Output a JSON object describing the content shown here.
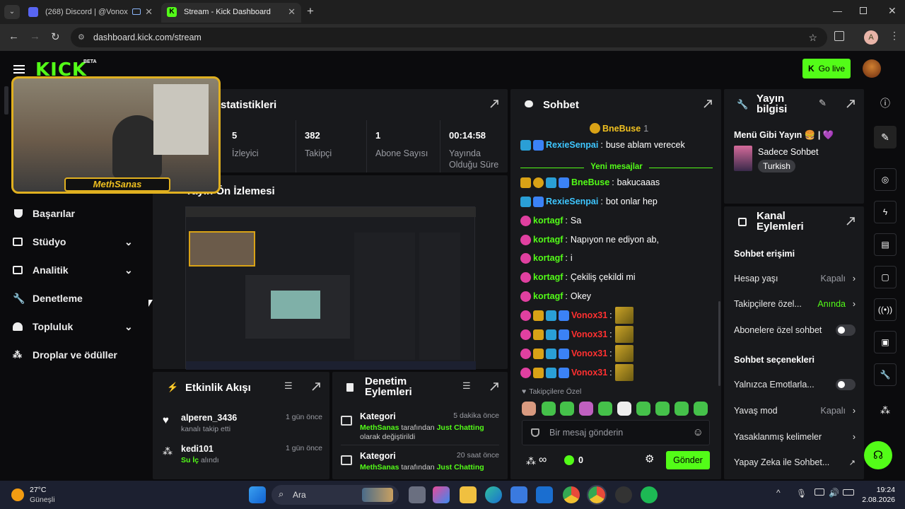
{
  "browser": {
    "tabs": [
      {
        "title": "(268) Discord | @Vonox",
        "badge": "268"
      },
      {
        "title": "Stream - Kick Dashboard"
      }
    ],
    "url": "dashboard.kick.com/stream",
    "profile_initial": "A"
  },
  "header": {
    "logo": "KICK",
    "logo_badge": "BETA",
    "go_live": "Go live"
  },
  "webcam": {
    "streamer_name": "MethSanas"
  },
  "sidebar": {
    "items": [
      {
        "label": "Başarılar",
        "icon": "trophy-icon",
        "expandable": false
      },
      {
        "label": "Stüdyo",
        "icon": "studio-icon",
        "expandable": true
      },
      {
        "label": "Analitik",
        "icon": "analytics-icon",
        "expandable": true
      },
      {
        "label": "Denetleme",
        "icon": "wrench-icon",
        "expandable": false
      },
      {
        "label": "Topluluk",
        "icon": "community-icon",
        "expandable": true
      },
      {
        "label": "Droplar ve ödüller",
        "icon": "drops-icon",
        "expandable": false
      }
    ]
  },
  "stats": {
    "title": "statistikleri",
    "items": [
      {
        "value": "5",
        "label": "İzleyici"
      },
      {
        "value": "382",
        "label": "Takipçi"
      },
      {
        "value": "1",
        "label": "Abone Sayısı"
      },
      {
        "value": "00:14:58",
        "label": "Yayında Olduğu Süre"
      }
    ]
  },
  "preview": {
    "title": "Yayın Ön İzlemesi"
  },
  "activity": {
    "title": "Etkinlik Akışı",
    "items": [
      {
        "user": "alperen_3436",
        "desc": "kanalı takip etti",
        "time": "1 gün önce",
        "icon": "heart-icon"
      },
      {
        "user": "kedi101",
        "desc_pre": "Su İç",
        "desc": "alındı",
        "time": "1 gün önce",
        "icon": "drops-icon"
      }
    ]
  },
  "moderation": {
    "title": "Denetim Eylemleri",
    "items": [
      {
        "title": "Kategori",
        "time": "5 dakika önce",
        "user": "MethSanas",
        "mid": "tarafından",
        "target": "Just Chatting",
        "rest": "olarak değiştirildi"
      },
      {
        "title": "Kategori",
        "time": "20 saat önce",
        "user": "MethSanas",
        "mid": "tarafından",
        "target": "Just Chatting",
        "rest": ""
      }
    ]
  },
  "chat": {
    "title": "Sohbet",
    "top_user": "BneBuse",
    "top_count": "1",
    "new_messages": "Yeni mesajlar",
    "messages": [
      {
        "user": "RexieSenpai",
        "text": "buse ablam verecek",
        "color": "#3ec6ff",
        "badges": [
          "b-og",
          "b-pin"
        ]
      },
      {
        "user": "BneBuse",
        "text": "bakucaaas",
        "color": "#53fc18",
        "badges": [
          "b-crown",
          "b-gold",
          "b-og",
          "b-pin"
        ]
      },
      {
        "user": "RexieSenpai",
        "text": "bot onlar hep",
        "color": "#3ec6ff",
        "badges": [
          "b-og",
          "b-pin"
        ]
      },
      {
        "user": "kortagf",
        "text": "Sa",
        "color": "#53fc18",
        "badges": [
          "b-sub"
        ]
      },
      {
        "user": "kortagf",
        "text": "Napıyon ne ediyon ab,",
        "color": "#53fc18",
        "badges": [
          "b-sub"
        ]
      },
      {
        "user": "kortagf",
        "text": "i",
        "color": "#53fc18",
        "badges": [
          "b-sub"
        ]
      },
      {
        "user": "kortagf",
        "text": "Çekiliş çekildi mi",
        "color": "#53fc18",
        "badges": [
          "b-sub"
        ]
      },
      {
        "user": "kortagf",
        "text": "Okey",
        "color": "#53fc18",
        "badges": [
          "b-sub"
        ]
      },
      {
        "user": "Vonox31",
        "text": "",
        "color": "#ff3030",
        "badges": [
          "b-sub",
          "b-crown",
          "b-og",
          "b-pin"
        ],
        "emote": true
      },
      {
        "user": "Vonox31",
        "text": "",
        "color": "#ff3030",
        "badges": [
          "b-sub",
          "b-crown",
          "b-og",
          "b-pin"
        ],
        "emote": true
      },
      {
        "user": "Vonox31",
        "text": "",
        "color": "#ff3030",
        "badges": [
          "b-sub",
          "b-crown",
          "b-og",
          "b-pin"
        ],
        "emote": true
      },
      {
        "user": "Vonox31",
        "text": "",
        "color": "#ff3030",
        "badges": [
          "b-sub",
          "b-crown",
          "b-og",
          "b-pin"
        ],
        "emote": true
      }
    ],
    "followers_only": "Takipçilere Özel",
    "input_placeholder": "Bir mesaj gönderin",
    "points": "0",
    "send": "Gönder"
  },
  "stream_info": {
    "title": "Yayın bilgisi",
    "stream_title": "Menü Gibi Yayın 🍔 | 💜",
    "category": "Sadece Sohbet",
    "tag": "Turkish"
  },
  "channel_actions": {
    "title": "Kanal Eylemleri",
    "chat_access": "Sohbet erişimi",
    "account_age": {
      "label": "Hesap yaşı",
      "value": "Kapalı"
    },
    "followers": {
      "label": "Takipçilere özel...",
      "value": "Anında"
    },
    "subscribers": {
      "label": "Abonelere özel sohbet"
    },
    "chat_options": "Sohbet seçenekleri",
    "emotes_only": {
      "label": "Yalnızca Emotlarla..."
    },
    "slow_mode": {
      "label": "Yavaş mod",
      "value": "Kapalı"
    },
    "banned_words": {
      "label": "Yasaklanmış kelimeler"
    },
    "ai_chat": {
      "label": "Yapay Zeka ile Sohbet..."
    }
  },
  "taskbar": {
    "temp": "27°C",
    "weather": "Güneşli",
    "search": "Ara",
    "time": "19:24",
    "date": "2.08.2026"
  },
  "colors": {
    "accent": "#53fc18",
    "panel": "#18191c",
    "bg": "#0b0b0d"
  }
}
